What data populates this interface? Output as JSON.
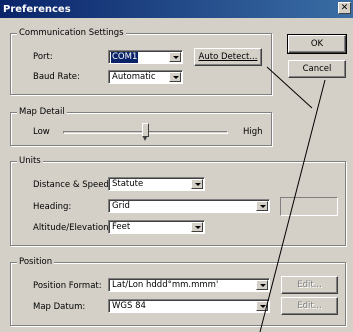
{
  "window": {
    "title": "Preferences",
    "close_glyph": "✕"
  },
  "buttons": {
    "ok": "OK",
    "cancel": "Cancel"
  },
  "communication": {
    "legend": "Communication Settings",
    "port_label": "Port:",
    "port_value": "COM1",
    "auto_detect_label": "Auto Detect...",
    "baud_label": "Baud Rate:",
    "baud_value": "Automatic"
  },
  "map_detail": {
    "legend": "Map Detail",
    "low_label": "Low",
    "high_label": "High",
    "level": 0.5
  },
  "units": {
    "legend": "Units",
    "distance_label": "Distance & Speed:",
    "distance_value": "Statute",
    "heading_label": "Heading:",
    "heading_value": "Grid",
    "altitude_label": "Altitude/Elevation:",
    "altitude_value": "Feet"
  },
  "position": {
    "legend": "Position",
    "format_label": "Position Format:",
    "format_value": "Lat/Lon hddd°mm.mmm'",
    "datum_label": "Map Datum:",
    "datum_value": "WGS 84",
    "edit_label": "Edit..."
  },
  "icons": {
    "close": "close-icon",
    "dropdown": "chevron-down-icon"
  }
}
